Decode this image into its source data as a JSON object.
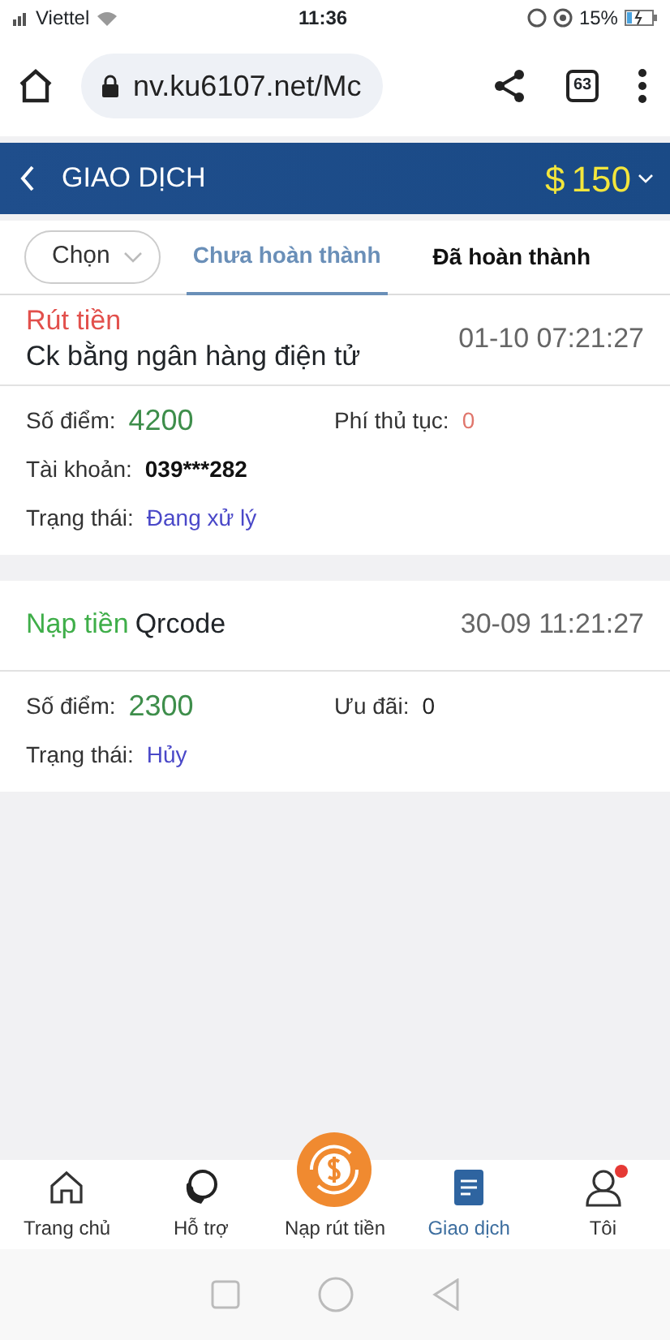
{
  "status_bar": {
    "carrier": "Viettel",
    "time": "11:36",
    "battery": "15%"
  },
  "browser": {
    "url": "nv.ku6107.net/Mc",
    "tab_count": "63"
  },
  "header": {
    "title": "GIAO DỊCH",
    "currency": "$",
    "balance": "150"
  },
  "filter": {
    "label": "Chọn"
  },
  "tabs": [
    {
      "label": "Chưa hoàn thành",
      "selected": true
    },
    {
      "label": "Đã hoàn thành",
      "selected": false
    }
  ],
  "transactions": [
    {
      "kind": "stacked",
      "type": "Rút tiền",
      "color": "#e2504c",
      "method": "Ck bằng ngân hàng điện tử",
      "time": "01-10 07:21:27",
      "rows": [
        [
          {
            "label": "Số điểm:",
            "value": "4200",
            "kind": "points"
          },
          {
            "label": "Phí thủ tục:",
            "value": "0",
            "kind": "fee"
          }
        ],
        [
          {
            "label": "Tài khoản:",
            "value": "039***282",
            "kind": "account"
          }
        ],
        [
          {
            "label": "Trạng thái:",
            "value": "Đang xử lý",
            "kind": "status"
          }
        ]
      ]
    },
    {
      "kind": "inline",
      "type": "Nạp tiền",
      "color": "#3fae49",
      "method": "Qrcode",
      "time": "30-09 11:21:27",
      "rows": [
        [
          {
            "label": "Số điểm:",
            "value": "2300",
            "kind": "points"
          },
          {
            "label": "Ưu đãi:",
            "value": "0",
            "kind": "plain"
          }
        ],
        [
          {
            "label": "Trạng thái:",
            "value": "Hủy",
            "kind": "status"
          }
        ]
      ]
    }
  ],
  "bottom_nav": [
    {
      "kind": "home",
      "label": "Trang chủ",
      "selected": false
    },
    {
      "kind": "support",
      "label": "Hỗ trợ",
      "selected": false
    },
    {
      "kind": "exchange",
      "label": "Nạp rút tiền",
      "selected": false
    },
    {
      "kind": "transactions",
      "label": "Giao dịch",
      "selected": true
    },
    {
      "kind": "profile",
      "label": "Tôi",
      "selected": false,
      "notification": true
    }
  ]
}
